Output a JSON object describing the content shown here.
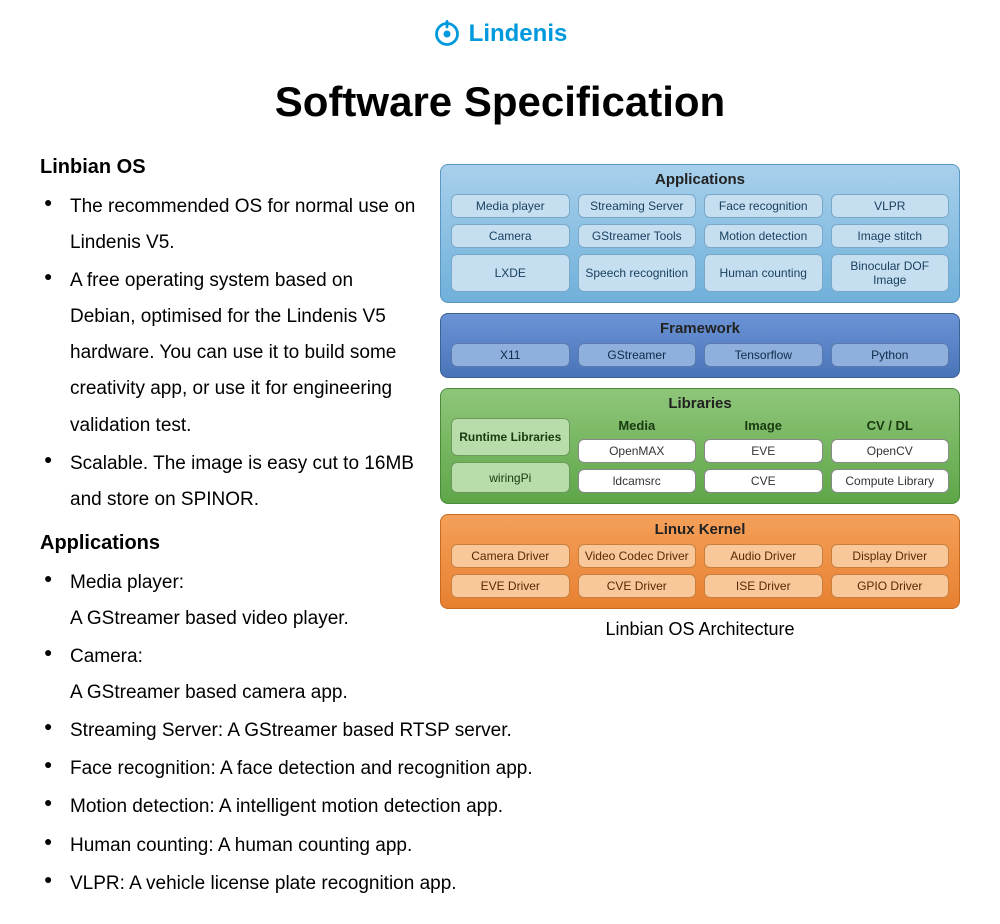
{
  "brand": "Lindenis",
  "title": "Software Specification",
  "section1": {
    "heading": "Linbian OS",
    "bullets": [
      "The recommended OS for normal use on Lindenis V5.",
      "A free operating system based on Debian, optimised for the Lindenis V5 hardware. You can use it to build some creativity app, or use it for engineering validation test.",
      "Scalable. The image is easy cut to 16MB and store on SPINOR."
    ]
  },
  "section2": {
    "heading": "Applications",
    "items": [
      {
        "label": "Media player:",
        "desc": "A GStreamer based video player."
      },
      {
        "label": "Camera:",
        "desc": "A GStreamer based camera app."
      },
      {
        "label": "Streaming Server: A GStreamer based RTSP server."
      },
      {
        "label": "Face recognition: A face detection and recognition app."
      },
      {
        "label": "Motion detection: A intelligent motion detection app."
      },
      {
        "label": "Human counting: A human counting app."
      },
      {
        "label": "VLPR: A vehicle license plate recognition app."
      }
    ]
  },
  "arch": {
    "applications": {
      "title": "Applications",
      "rows": [
        [
          "Media player",
          "Streaming Server",
          "Face recognition",
          "VLPR"
        ],
        [
          "Camera",
          "GStreamer Tools",
          "Motion detection",
          "Image stitch"
        ],
        [
          "LXDE",
          "Speech recognition",
          "Human counting",
          "Binocular DOF Image"
        ]
      ]
    },
    "framework": {
      "title": "Framework",
      "row": [
        "X11",
        "GStreamer",
        "Tensorflow",
        "Python"
      ]
    },
    "libraries": {
      "title": "Libraries",
      "runtime_title": "Runtime Libraries",
      "wiringpi": "wiringPi",
      "cols": [
        {
          "title": "Media",
          "items": [
            "OpenMAX",
            "ldcamsrc"
          ]
        },
        {
          "title": "Image",
          "items": [
            "EVE",
            "CVE"
          ]
        },
        {
          "title": "CV / DL",
          "items": [
            "OpenCV",
            "Compute Library"
          ]
        }
      ]
    },
    "kernel": {
      "title": "Linux Kernel",
      "rows": [
        [
          "Camera Driver",
          "Video Codec Driver",
          "Audio Driver",
          "Display Driver"
        ],
        [
          "EVE Driver",
          "CVE Driver",
          "ISE Driver",
          "GPIO Driver"
        ]
      ]
    },
    "caption": "Linbian OS Architecture"
  }
}
